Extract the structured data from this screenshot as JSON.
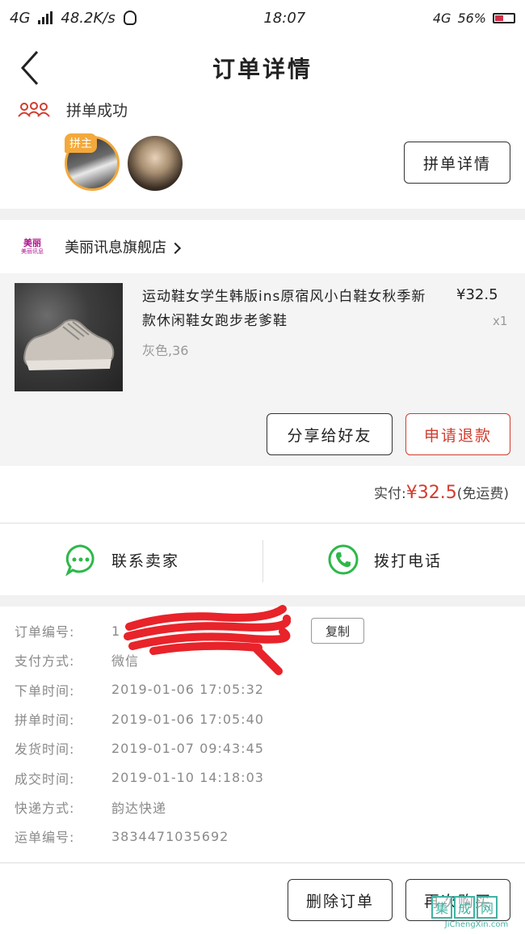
{
  "status_bar": {
    "network": "4G",
    "speed": "48.2K/s",
    "time": "18:07",
    "network_right": "4G",
    "battery_pct": "56%"
  },
  "header": {
    "title": "订单详情"
  },
  "group": {
    "status_text": "拼单成功",
    "host_badge": "拼主",
    "detail_button": "拼单详情"
  },
  "shop": {
    "logo_top": "美丽",
    "logo_bottom": "美丽讯息",
    "name": "美丽讯息旗舰店"
  },
  "product": {
    "title": "运动鞋女学生韩版ins原宿风小白鞋女秋季新款休闲鞋女跑步老爹鞋",
    "price": "¥32.5",
    "quantity": "x1",
    "spec": "灰色,36"
  },
  "actions": {
    "share": "分享给好友",
    "refund": "申请退款"
  },
  "payment": {
    "paid_label": "实付:",
    "paid_amount": "¥32.5",
    "shipping_note": "(免运费)"
  },
  "contact": {
    "seller": "联系卖家",
    "call": "拨打电话"
  },
  "order_info": [
    {
      "label": "订单编号:",
      "value": "1"
    },
    {
      "label": "支付方式:",
      "value": "微信"
    },
    {
      "label": "下单时间:",
      "value": "2019-01-06 17:05:32"
    },
    {
      "label": "拼单时间:",
      "value": "2019-01-06 17:05:40"
    },
    {
      "label": "发货时间:",
      "value": "2019-01-07 09:43:45"
    },
    {
      "label": "成交时间:",
      "value": "2019-01-10 14:18:03"
    },
    {
      "label": "快递方式:",
      "value": "韵达快递"
    },
    {
      "label": "运单编号:",
      "value": "3834471035692"
    }
  ],
  "copy_button": "复制",
  "bottom": {
    "delete": "删除订单",
    "rebuy": "再次购买"
  },
  "watermark": {
    "chars": [
      "集",
      "成",
      "网"
    ],
    "url": "JiChengXin.com"
  }
}
